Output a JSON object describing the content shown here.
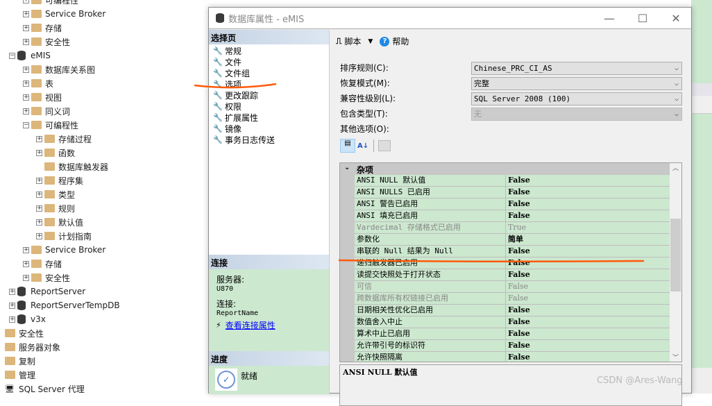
{
  "tree": [
    {
      "label": "可编程性",
      "level": 2,
      "exp": "+",
      "type": "folder"
    },
    {
      "label": "Service Broker",
      "level": 2,
      "exp": "+",
      "type": "folder"
    },
    {
      "label": "存储",
      "level": 2,
      "exp": "+",
      "type": "folder"
    },
    {
      "label": "安全性",
      "level": 2,
      "exp": "+",
      "type": "folder"
    },
    {
      "label": "eMIS",
      "level": 1,
      "exp": "-",
      "type": "db"
    },
    {
      "label": "数据库关系图",
      "level": 2,
      "exp": "+",
      "type": "folder"
    },
    {
      "label": "表",
      "level": 2,
      "exp": "+",
      "type": "folder"
    },
    {
      "label": "视图",
      "level": 2,
      "exp": "+",
      "type": "folder"
    },
    {
      "label": "同义词",
      "level": 2,
      "exp": "+",
      "type": "folder"
    },
    {
      "label": "可编程性",
      "level": 2,
      "exp": "-",
      "type": "folder"
    },
    {
      "label": "存储过程",
      "level": 3,
      "exp": "+",
      "type": "folder"
    },
    {
      "label": "函数",
      "level": 3,
      "exp": "+",
      "type": "folder"
    },
    {
      "label": "数据库触发器",
      "level": 3,
      "exp": "",
      "type": "folder"
    },
    {
      "label": "程序集",
      "level": 3,
      "exp": "+",
      "type": "folder"
    },
    {
      "label": "类型",
      "level": 3,
      "exp": "+",
      "type": "folder"
    },
    {
      "label": "规则",
      "level": 3,
      "exp": "+",
      "type": "folder"
    },
    {
      "label": "默认值",
      "level": 3,
      "exp": "+",
      "type": "folder"
    },
    {
      "label": "计划指南",
      "level": 3,
      "exp": "+",
      "type": "folder"
    },
    {
      "label": "Service Broker",
      "level": 2,
      "exp": "+",
      "type": "folder"
    },
    {
      "label": "存储",
      "level": 2,
      "exp": "+",
      "type": "folder"
    },
    {
      "label": "安全性",
      "level": 2,
      "exp": "+",
      "type": "folder"
    },
    {
      "label": "ReportServer",
      "level": 1,
      "exp": "+",
      "type": "db"
    },
    {
      "label": "ReportServerTempDB",
      "level": 1,
      "exp": "+",
      "type": "db"
    },
    {
      "label": "v3x",
      "level": 1,
      "exp": "+",
      "type": "db"
    },
    {
      "label": "安全性",
      "level": 0,
      "exp": "",
      "type": "folder"
    },
    {
      "label": "服务器对象",
      "level": 0,
      "exp": "",
      "type": "folder"
    },
    {
      "label": "复制",
      "level": 0,
      "exp": "",
      "type": "folder"
    },
    {
      "label": "管理",
      "level": 0,
      "exp": "",
      "type": "folder"
    },
    {
      "label": "SQL Server 代理",
      "level": 0,
      "exp": "",
      "type": "agent"
    }
  ],
  "dialog": {
    "title": "数据库属性 - eMIS",
    "select_page": "选择页",
    "pages": [
      "常规",
      "文件",
      "文件组",
      "选项",
      "更改跟踪",
      "权限",
      "扩展属性",
      "镜像",
      "事务日志传送"
    ],
    "connection": {
      "header": "连接",
      "server_label": "服务器:",
      "server": "U870",
      "conn_label": "连接:",
      "conn": "ReportName",
      "link": "查看连接属性"
    },
    "progress": {
      "header": "进度",
      "status": "就绪"
    },
    "toolbar": {
      "script": "脚本",
      "help": "帮助"
    },
    "fields": [
      {
        "label": "排序规则(C):",
        "value": "Chinese_PRC_CI_AS",
        "disabled": false
      },
      {
        "label": "恢复模式(M):",
        "value": "完整",
        "disabled": false
      },
      {
        "label": "兼容性级别(L):",
        "value": "SQL Server 2008 (100)",
        "disabled": false
      },
      {
        "label": "包含类型(T):",
        "value": "无",
        "disabled": true
      }
    ],
    "other_options": "其他选项(O):",
    "category": "杂项",
    "rows": [
      {
        "name": "ANSI NULL 默认值",
        "value": "False",
        "gray": false
      },
      {
        "name": "ANSI NULLS 已启用",
        "value": "False",
        "gray": false
      },
      {
        "name": "ANSI 警告已启用",
        "value": "False",
        "gray": false
      },
      {
        "name": "ANSI 填充已启用",
        "value": "False",
        "gray": false
      },
      {
        "name": "Vardecimal 存储格式已启用",
        "value": "True",
        "gray": true
      },
      {
        "name": "参数化",
        "value": "简单",
        "gray": false
      },
      {
        "name": "串联的 Null 结果为 Null",
        "value": "False",
        "gray": false
      },
      {
        "name": "递归触发器已启用",
        "value": "False",
        "gray": false
      },
      {
        "name": "读提交快照处于打开状态",
        "value": "False",
        "gray": false
      },
      {
        "name": "可信",
        "value": "False",
        "gray": true
      },
      {
        "name": "跨数据库所有权链接已启用",
        "value": "False",
        "gray": true
      },
      {
        "name": "日期相关性优化已启用",
        "value": "False",
        "gray": false
      },
      {
        "name": "数值舍入中止",
        "value": "False",
        "gray": false
      },
      {
        "name": "算术中止已启用",
        "value": "False",
        "gray": false
      },
      {
        "name": "允许带引号的标识符",
        "value": "False",
        "gray": false
      },
      {
        "name": "允许快照隔离",
        "value": "False",
        "gray": false
      }
    ],
    "description": "ANSI NULL 默认值"
  },
  "watermark": "CSDN @Ares-Wang",
  "colors": {
    "annotation": "#ff5a0a",
    "grid_row": "#cce8cf",
    "link": "#0000ff"
  }
}
